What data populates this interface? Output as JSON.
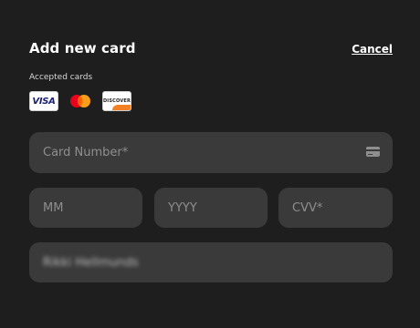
{
  "modal": {
    "title": "Add new card",
    "cancel_label": "Cancel",
    "accepted_label": "Accepted cards"
  },
  "card_brands": [
    {
      "name": "visa",
      "label": "VISA"
    },
    {
      "name": "mastercard",
      "label": ""
    },
    {
      "name": "discover",
      "label": "DISCOVER"
    }
  ],
  "form": {
    "card_number_placeholder": "Card Number*",
    "month_placeholder": "MM",
    "year_placeholder": "YYYY",
    "cvv_placeholder": "CVV*",
    "cardholder_name_value": "Rikki Hellmunds"
  },
  "colors": {
    "background": "#1e1e1e",
    "field_background": "#3a3a3a",
    "placeholder": "#8e8e8e",
    "mastercard_red": "#eb001b",
    "mastercard_yellow": "#f79e1b",
    "discover_orange": "#f48024",
    "visa_blue": "#1a1f71"
  }
}
